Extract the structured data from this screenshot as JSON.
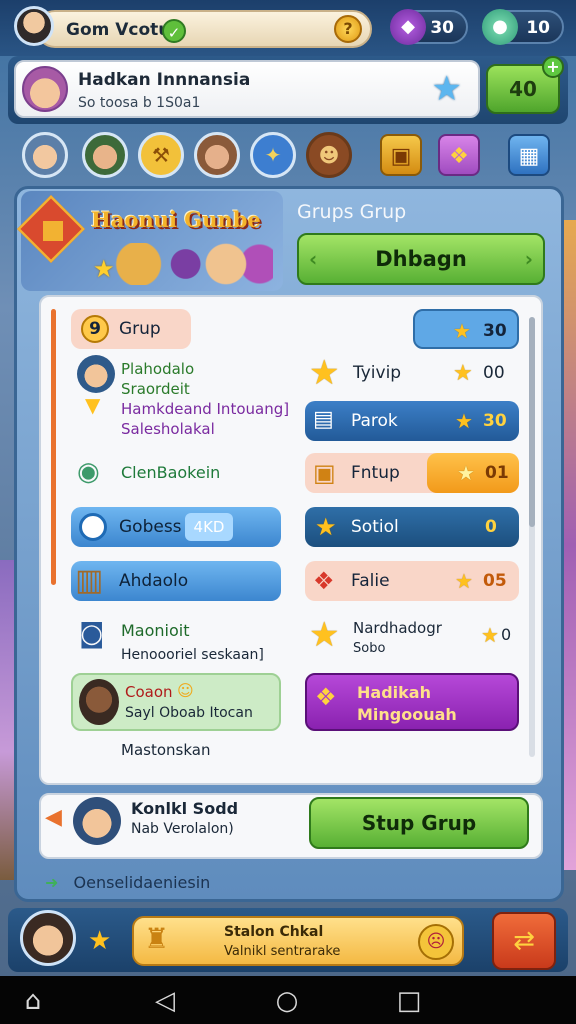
{
  "topbar": {
    "player_name": "Gom Vcotu",
    "check_icon": "check-icon",
    "coin_icon": "coin-icon",
    "gems_value": "30",
    "tokens_value": "10"
  },
  "profile": {
    "name": "Hadkan Innnansia",
    "subtitle": "So toosa b 1S0a1",
    "level_value": "40",
    "plus_label": "+"
  },
  "game": {
    "title": "Haonui Gunbe",
    "groups_title": "Grups Grup",
    "main_button": "Dhbagn"
  },
  "list": {
    "group_badge_num": "9",
    "group_label": "Grup",
    "group_value": "30",
    "left_items": [
      {
        "title": "Plahodalo",
        "line2": "Sraordeit",
        "line3": "Hamkdeand Intouang]",
        "line4": "Salesholakal"
      },
      {
        "title": "ClenBaokein"
      },
      {
        "title": "Gobess",
        "value": "4KD"
      },
      {
        "title": "Ahdaolo"
      },
      {
        "title": "Maonioit",
        "sub": "Henoooriel seskaan]"
      },
      {
        "title": "Coaon",
        "sub": "Sayl Oboab Itocan"
      },
      {
        "title": "Mastonskan"
      }
    ],
    "right_items": [
      {
        "label": "Tyivip",
        "value": "00"
      },
      {
        "label": "Parok",
        "value": "30"
      },
      {
        "label": "Fntup",
        "value": "01"
      },
      {
        "label": "Sotiol",
        "value": "0"
      },
      {
        "label": "Falie",
        "value": "05"
      },
      {
        "label": "Nardhadogr",
        "sub": "Sobo",
        "value": "0"
      },
      {
        "label": "Hadikah",
        "sub": "Mingoouah"
      }
    ]
  },
  "bottom_card": {
    "name": "Konlkl Sodd",
    "sub": "Nab Verolalon)",
    "button": "Stup Grup"
  },
  "footer_note": "Oenselidaeniesin",
  "bottom_bar": {
    "title": "Stalon Chkal",
    "sub": "Valnikl sentrarake"
  },
  "colors": {
    "accent_green": "#58b034",
    "accent_orange": "#e9722e",
    "panel_blue": "#5f8cbd",
    "purple": "#9b2fc4"
  }
}
